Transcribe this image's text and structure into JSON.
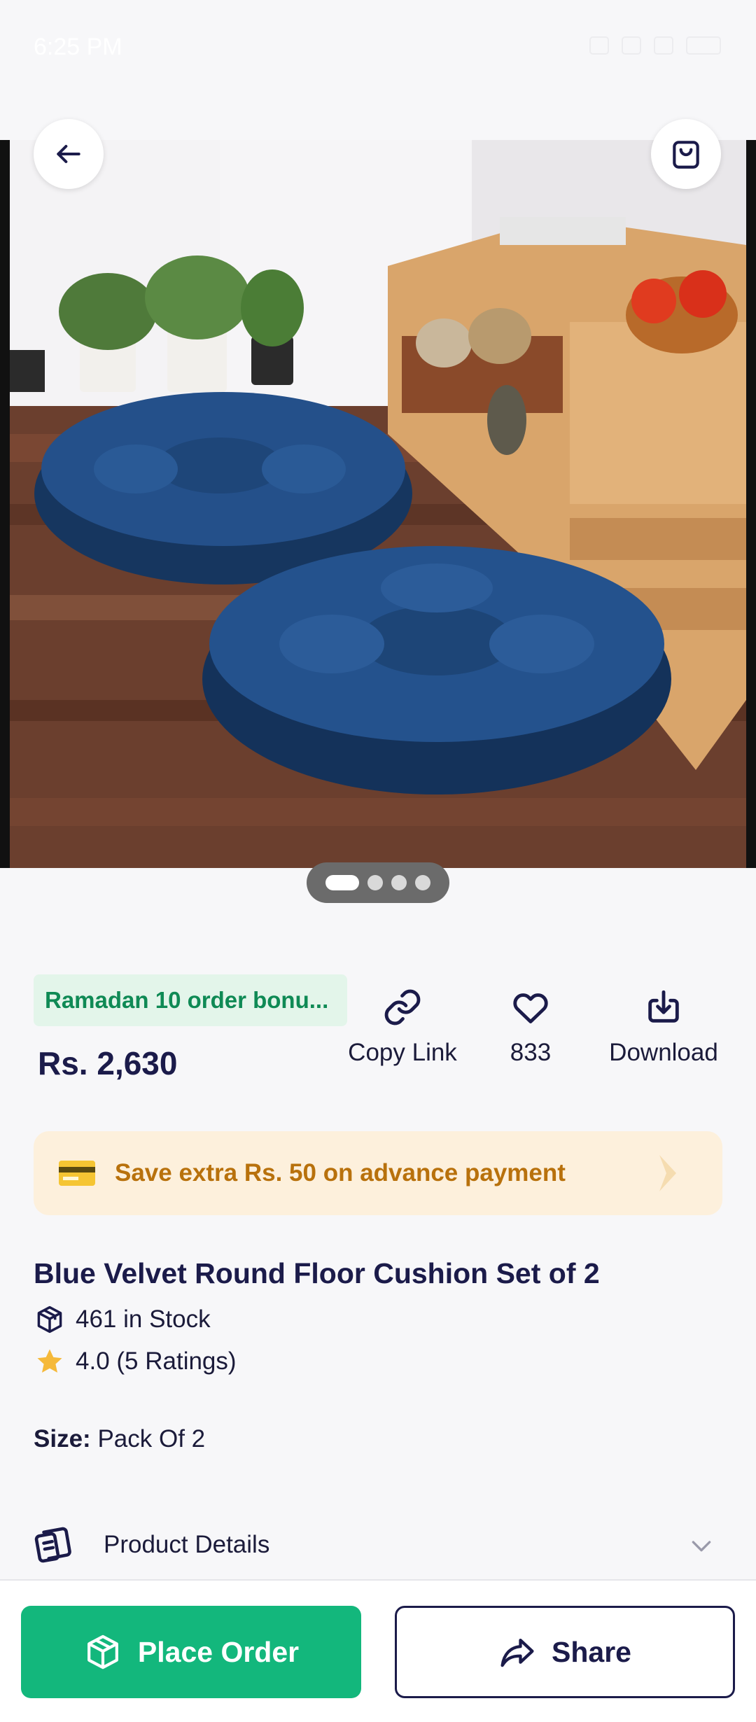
{
  "status_bar": {
    "time": "6:25 PM"
  },
  "header": {
    "back_icon": "arrow-left-icon",
    "cart_icon": "shopping-bag-icon"
  },
  "gallery": {
    "image_count": 4,
    "active_index": 0
  },
  "promo_badge": "Ramadan 10 order bonu...",
  "price": "Rs. 2,630",
  "actions": {
    "copy_link": "Copy Link",
    "likes": "833",
    "download": "Download"
  },
  "save_banner": {
    "text": "Save extra Rs. 50 on advance payment",
    "icon": "credit-card-icon"
  },
  "product": {
    "title": "Blue Velvet Round Floor Cushion Set of 2",
    "stock": "461 in Stock",
    "rating": "4.0 (5 Ratings)",
    "size_label": "Size:",
    "size_value": "Pack Of 2"
  },
  "details": {
    "label": "Product Details"
  },
  "bottom": {
    "place_order": "Place Order",
    "share": "Share"
  },
  "colors": {
    "primary_green": "#13B77C",
    "navy": "#1B1B4A",
    "banner_bg": "#FDF0DC",
    "banner_text": "#B8710C",
    "badge_bg": "#E3F5EA",
    "badge_text": "#0F8A55"
  }
}
